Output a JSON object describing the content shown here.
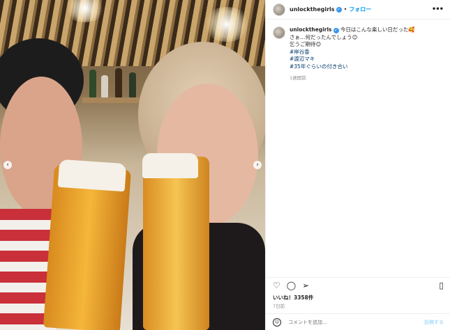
{
  "post": {
    "username": "unlockthegirls",
    "follow_label": "フォロー",
    "more_icon": "•••",
    "caption_lines": [
      "今日はこんな楽しい日だった🥰",
      "さぁ…何だったんでしょう😊",
      "乞うご期待😊"
    ],
    "hashtags": [
      "#岸谷香",
      "#渡辺マキ",
      "#35年ぐらいの付き合い"
    ],
    "caption_time": "1週間前",
    "likes": "いいね！3358件",
    "posted_ago": "7日前",
    "comment_placeholder": "コメントを追加...",
    "post_button": "投稿する"
  },
  "icons": {
    "like": "heart-icon",
    "comment": "comment-icon",
    "share": "share-icon",
    "save": "bookmark-icon",
    "emoji": "emoji-icon",
    "prev": "chevron-left-icon",
    "next": "chevron-right-icon"
  },
  "colors": {
    "link": "#0095f6",
    "verified": "#3897f0",
    "hashtag": "#00376b"
  }
}
